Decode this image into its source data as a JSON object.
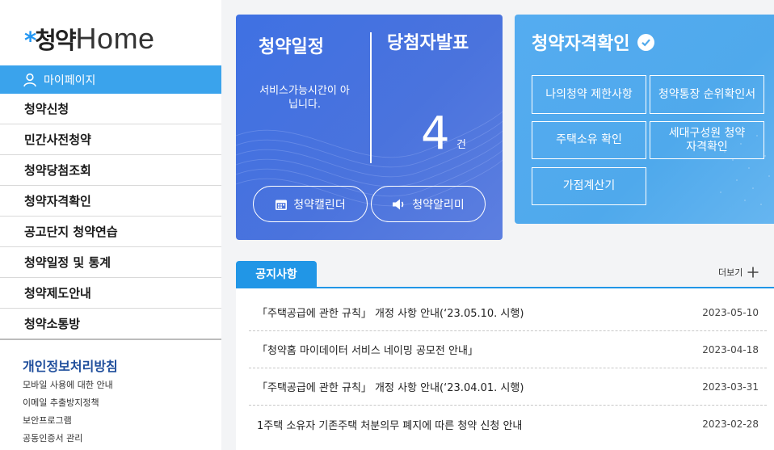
{
  "logo": {
    "korean": "청약",
    "english": "Home"
  },
  "sidebar": {
    "mypage_label": "마이페이지",
    "items": [
      {
        "label": "청약신청"
      },
      {
        "label": "민간사전청약"
      },
      {
        "label": "청약당첨조회"
      },
      {
        "label": "청약자격확인"
      },
      {
        "label": "공고단지 청약연습"
      },
      {
        "label": "청약일정 및 통계"
      },
      {
        "label": "청약제도안내"
      },
      {
        "label": "청약소통방"
      }
    ],
    "privacy_title": "개인정보처리방침",
    "sublinks": [
      {
        "label": "모바일 사용에 대한 안내"
      },
      {
        "label": "이메일 추출방지정책"
      },
      {
        "label": "보안프로그램"
      },
      {
        "label": "공동인증서 관리"
      }
    ]
  },
  "schedule_card": {
    "title": "청약일정",
    "message": "서비스가능시간이 아닙니다.",
    "winners_title": "당첨자발표",
    "winners_count": "4",
    "winners_unit": "건",
    "calendar_label": "청약캘린더",
    "alarm_label": "청약알리미"
  },
  "qualify_card": {
    "title": "청약자격확인",
    "buttons": [
      {
        "label": "나의청약 제한사항"
      },
      {
        "label": "청약통장 순위확인서"
      },
      {
        "label": "주택소유 확인"
      },
      {
        "label": "세대구성원 청약자격확인"
      },
      {
        "label": "가점계산기"
      }
    ]
  },
  "notices": {
    "tab_label": "공지사항",
    "more_label": "더보기",
    "items": [
      {
        "title": "「주택공급에 관한 규칙」 개정 사항 안내(‘23.05.10. 시행)",
        "date": "2023-05-10"
      },
      {
        "title": "「청약홈 마이데이터 서비스 네이밍 공모전 안내」",
        "date": "2023-04-18"
      },
      {
        "title": "「주택공급에 관한 규칙」 개정 사항 안내(‘23.04.01. 시행)",
        "date": "2023-03-31"
      },
      {
        "title": "1주택 소유자 기존주택 처분의무 폐지에 따른 청약 신청 안내",
        "date": "2023-02-28"
      }
    ]
  },
  "colors": {
    "accent": "#3aa3ec",
    "schedule_card": "#4a73dd",
    "qualify_card": "#55acf0",
    "notice_tab": "#2196e6",
    "privacy_title": "#1f4e9c"
  }
}
